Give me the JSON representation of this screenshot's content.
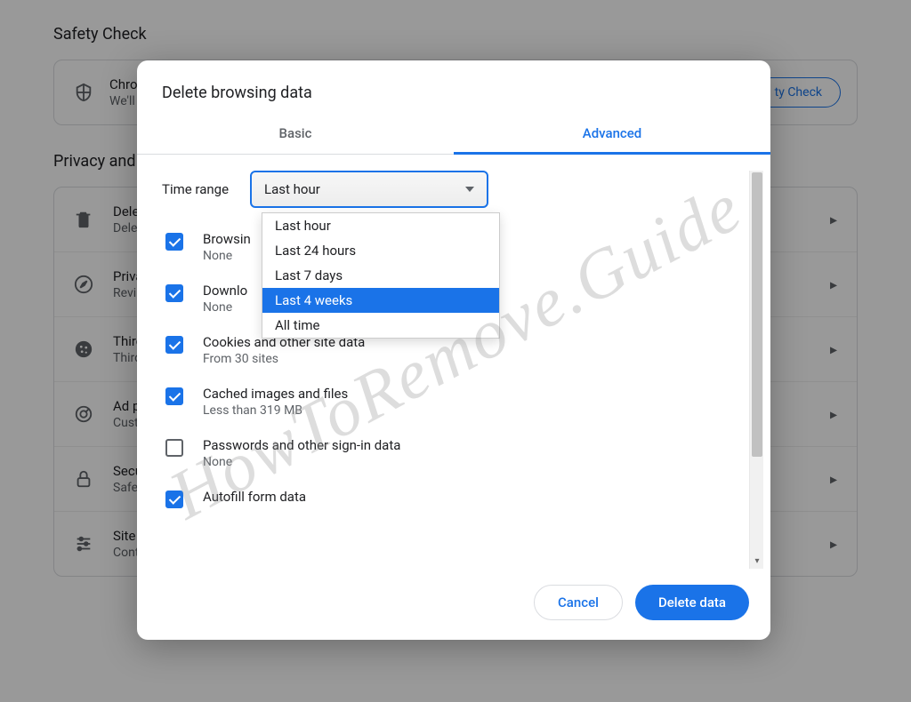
{
  "bg": {
    "safety_title": "Safety Check",
    "safety_line1": "Chron",
    "safety_line2": "We'll",
    "safety_button": "ty Check",
    "privacy_title": "Privacy and s",
    "rows": [
      {
        "title": "Delet",
        "sub": "Delet"
      },
      {
        "title": "Priva",
        "sub": "Revi"
      },
      {
        "title": "Third",
        "sub": "Third"
      },
      {
        "title": "Ad p",
        "sub": "Custo"
      },
      {
        "title": "Secu",
        "sub": "Safe"
      },
      {
        "title": "Site s",
        "sub": "Controls what information sites can use and show (location, camera, pop-ups, and more)"
      }
    ]
  },
  "modal": {
    "title": "Delete browsing data",
    "tabs": {
      "basic": "Basic",
      "advanced": "Advanced"
    },
    "time_range_label": "Time range",
    "time_range_value": "Last hour",
    "time_options": [
      "Last hour",
      "Last 24 hours",
      "Last 7 days",
      "Last 4 weeks",
      "All time"
    ],
    "highlighted_option": "Last 4 weeks",
    "items": [
      {
        "checked": true,
        "title": "Browsin",
        "sub": "None"
      },
      {
        "checked": true,
        "title": "Downlo",
        "sub": "None"
      },
      {
        "checked": true,
        "title": "Cookies and other site data",
        "sub": "From 30 sites"
      },
      {
        "checked": true,
        "title": "Cached images and files",
        "sub": "Less than 319 MB"
      },
      {
        "checked": false,
        "title": "Passwords and other sign-in data",
        "sub": "None"
      },
      {
        "checked": true,
        "title": "Autofill form data",
        "sub": ""
      }
    ],
    "cancel": "Cancel",
    "confirm": "Delete data"
  },
  "watermark": "HowToRemove.Guide"
}
